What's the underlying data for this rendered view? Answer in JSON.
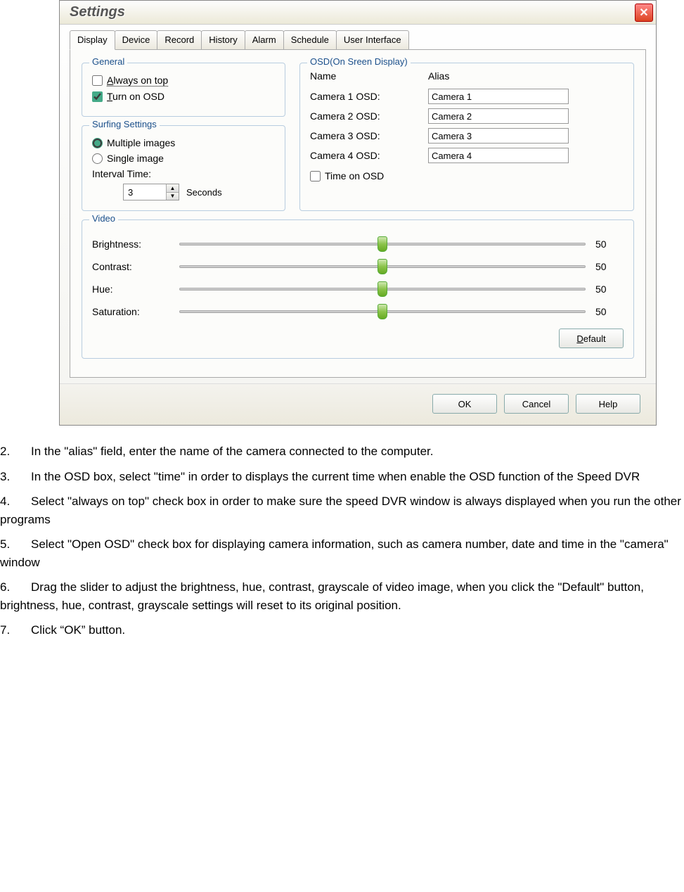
{
  "dialog": {
    "title": "Settings",
    "tabs": [
      "Display",
      "Device",
      "Record",
      "History",
      "Alarm",
      "Schedule",
      "User Interface"
    ],
    "active_tab": "Display",
    "general": {
      "legend": "General",
      "always_on_top_label": "lways on top",
      "always_on_top_prefix": "A",
      "always_on_top_checked": false,
      "turn_on_osd_prefix": "T",
      "turn_on_osd_label": "urn on OSD",
      "turn_on_osd_checked": true
    },
    "surfing": {
      "legend": "Surfing Settings",
      "multiple_label": "Multiple images",
      "single_label": "Single image",
      "selected": "multiple",
      "interval_label": "Interval Time:",
      "interval_value": "3",
      "interval_unit": "Seconds"
    },
    "osd": {
      "legend": "OSD(On Sreen Display)",
      "name_header": "Name",
      "alias_header": "Alias",
      "rows": [
        {
          "name": "Camera 1 OSD:",
          "alias": "Camera 1"
        },
        {
          "name": "Camera 2 OSD:",
          "alias": "Camera 2"
        },
        {
          "name": "Camera 3 OSD:",
          "alias": "Camera 3"
        },
        {
          "name": "Camera 4 OSD:",
          "alias": "Camera 4"
        }
      ],
      "time_label": "Time on OSD",
      "time_checked": false
    },
    "video": {
      "legend": "Video",
      "sliders": [
        {
          "label": "Brightness:",
          "value": 50
        },
        {
          "label": "Contrast:",
          "value": 50
        },
        {
          "label": "Hue:",
          "value": 50
        },
        {
          "label": "Saturation:",
          "value": 50
        }
      ],
      "default_prefix": "D",
      "default_label": "efault"
    },
    "buttons": {
      "ok": "OK",
      "cancel": "Cancel",
      "help": "Help"
    }
  },
  "instructions": {
    "i2": "In the \"alias\" field, enter the name of the camera connected to the computer.",
    "i3": "In the OSD box, select \"time\" in order to displays the current time when enable the OSD function of the Speed DVR",
    "i4": "Select \"always on top\" check box in order to make sure the speed DVR window is always displayed when you run the other programs",
    "i5": "Select \"Open OSD\" check box for displaying camera information, such as camera number, date and time in the \"camera\" window",
    "i6": "Drag the slider to adjust the brightness, hue, contrast, grayscale of video image, when you click the \"Default\" button, brightness, hue, contrast, grayscale settings will reset to its original position.",
    "i7": "Click “OK” button."
  }
}
